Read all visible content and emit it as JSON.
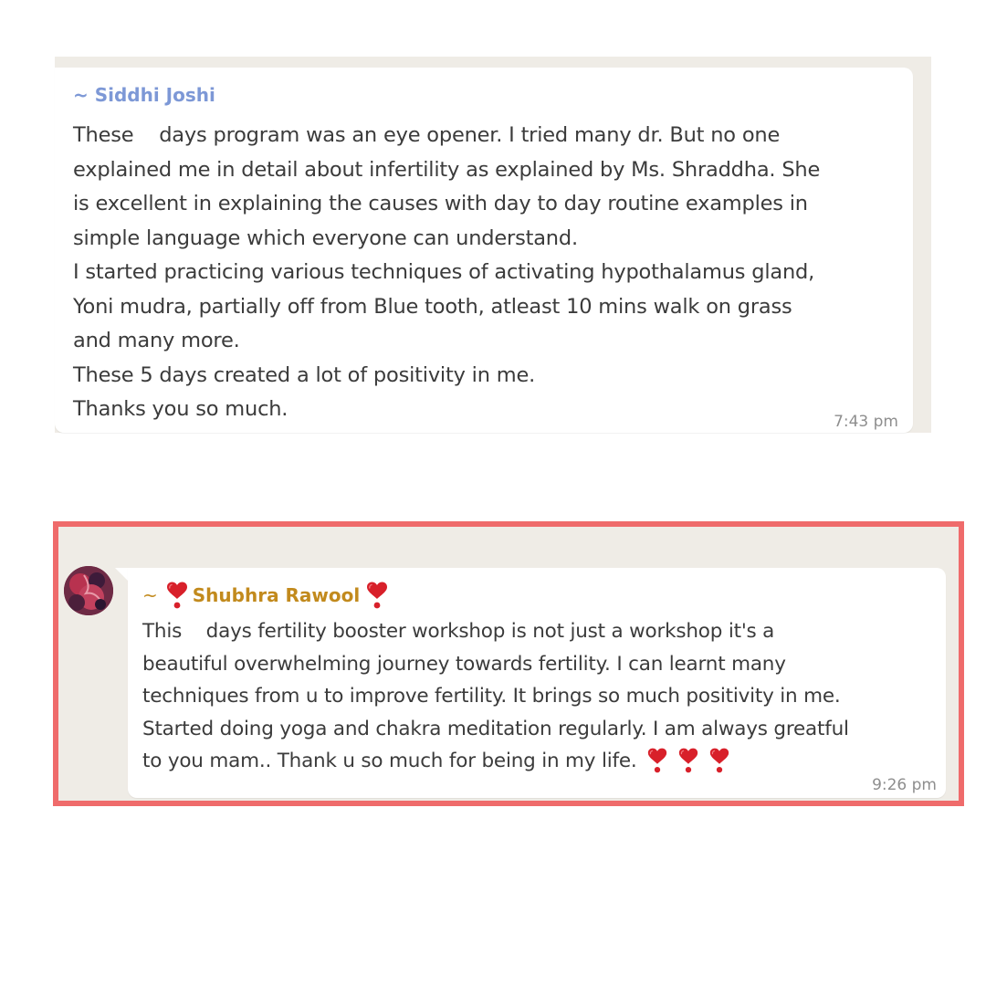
{
  "messages": [
    {
      "sender": "~ Siddhi Joshi",
      "lines": [
        "These    days program was an eye opener. I tried many dr. But no one",
        "explained me in detail about infertility as explained by Ms. Shraddha. She",
        "is excellent in explaining the causes with day to day routine examples in",
        "simple language which everyone can understand.",
        "I started practicing various techniques of activating hypothalamus gland,",
        "Yoni mudra, partially off from Blue tooth, atleast 10 mins walk on grass",
        "and many more.",
        "These 5 days created a lot of positivity in me.",
        "Thanks you so much."
      ],
      "time": "7:43 pm",
      "name_color": "#7d98d6"
    },
    {
      "sender_prefix": "~",
      "sender": "Shubhra Rawool",
      "sender_icon": "heart-exclamation-icon",
      "lines": [
        "This    days fertility booster workshop is not just a workshop it's a",
        "beautiful overwhelming journey towards fertility. I can learnt many",
        "techniques from u to improve fertility. It brings so much positivity in me.",
        "Started doing yoga and chakra meditation regularly. I am always greatful",
        "to you mam.. Thank u so much for being in my life."
      ],
      "trailing_icons": [
        "heart-exclamation-icon",
        "heart-exclamation-icon",
        "heart-exclamation-icon"
      ],
      "time": "9:26 pm",
      "name_color": "#c28a1d",
      "highlight_border_color": "#ef6b6b"
    }
  ]
}
